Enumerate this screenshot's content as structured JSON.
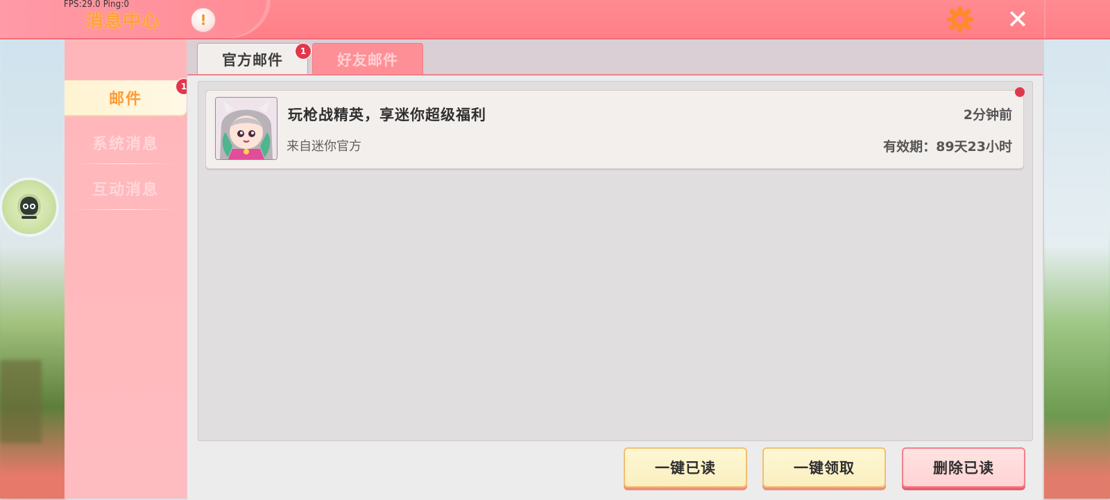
{
  "debug": {
    "fps_text": "FPS:29.0  Ping:0"
  },
  "header": {
    "title": "消息中心",
    "info_icon": "exclamation-icon",
    "settings_icon": "gear-icon",
    "close_icon": "close-icon",
    "accent_color": "#ff7e86"
  },
  "sidebar": {
    "items": [
      {
        "label": "邮件",
        "badge": "1",
        "active": true
      },
      {
        "label": "系统消息",
        "active": false
      },
      {
        "label": "互动消息",
        "active": false
      }
    ]
  },
  "tabs": [
    {
      "label": "官方邮件",
      "badge": "1",
      "active": true
    },
    {
      "label": "好友邮件",
      "active": false
    }
  ],
  "mails": [
    {
      "title": "玩枪战精英，享迷你超级福利",
      "from": "来自迷你官方",
      "time": "2分钟前",
      "expire": "有效期：89天23小时",
      "unread": true
    }
  ],
  "actions": {
    "read_all": "一键已读",
    "claim_all": "一键领取",
    "delete_read": "删除已读"
  }
}
